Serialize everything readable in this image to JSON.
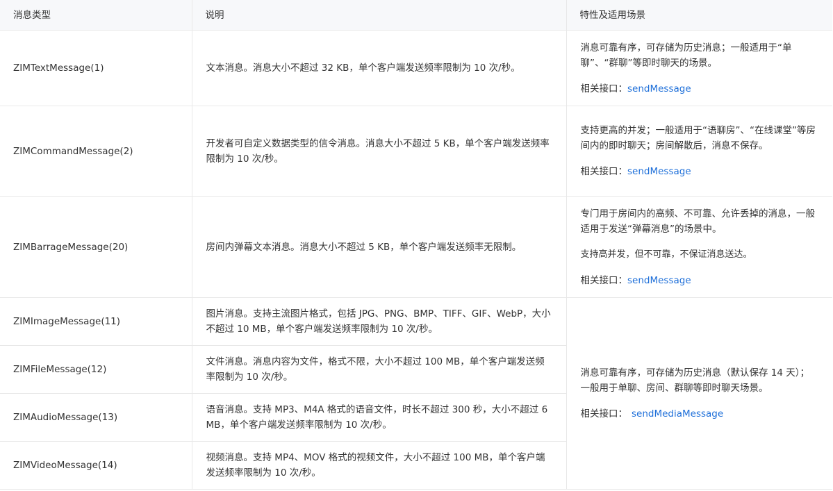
{
  "headers": [
    "消息类型",
    "说明",
    "特性及适用场景"
  ],
  "rows": [
    {
      "type": "ZIMTextMessage(1)",
      "desc": "文本消息。消息大小不超过 32 KB，单个客户端发送频率限制为 10 次/秒。",
      "feat_lines": [
        "消息可靠有序，可存储为历史消息；一般适用于“单聊”、“群聊”等即时聊天的场景。"
      ],
      "api_label": "相关接口：",
      "api": "sendMessage"
    },
    {
      "type": "ZIMCommandMessage(2)",
      "desc": "开发者可自定义数据类型的信令消息。消息大小不超过 5 KB，单个客户端发送频率限制为 10 次/秒。",
      "feat_lines": [
        "支持更高的并发；一般适用于“语聊房”、“在线课堂”等房间内的即时聊天；房间解散后，消息不保存。"
      ],
      "api_label": "相关接口：",
      "api": "sendMessage"
    },
    {
      "type": "ZIMBarrageMessage(20)",
      "desc": "房间内弹幕文本消息。消息大小不超过 5 KB，单个客户端发送频率无限制。",
      "feat_lines": [
        "专门用于房间内的高频、不可靠、允许丢掉的消息，一般适用于发送“弹幕消息”的场景中。",
        "支持高并发，但不可靠，不保证消息送达。"
      ],
      "api_label": "相关接口：",
      "api": "sendMessage"
    },
    {
      "type": "ZIMImageMessage(11)",
      "desc": "图片消息。支持主流图片格式，包括 JPG、PNG、BMP、TIFF、GIF、WebP，大小不超过 10 MB，单个客户端发送频率限制为 10 次/秒。"
    },
    {
      "type": "ZIMFileMessage(12)",
      "desc": "文件消息。消息内容为文件，格式不限，大小不超过 100 MB，单个客户端发送频率限制为 10 次/秒。"
    },
    {
      "type": "ZIMAudioMessage(13)",
      "desc": "语音消息。支持 MP3、M4A 格式的语音文件，时长不超过 300 秒，大小不超过 6 MB，单个客户端发送频率限制为 10 次/秒。"
    },
    {
      "type": "ZIMVideoMessage(14)",
      "desc": "视频消息。支持 MP4、MOV 格式的视频文件，大小不超过 100 MB，单个客户端发送频率限制为 10 次/秒。"
    }
  ],
  "media_feature": {
    "text": "消息可靠有序，可存储为历史消息（默认保存 14 天）；一般用于单聊、房间、群聊等即时聊天场景。",
    "api_label": "相关接口：",
    "api": "sendMediaMessage"
  },
  "colors": {
    "link": "#1e6fd9",
    "header_bg": "#f7f8fa",
    "border": "#e8e8e8",
    "text": "#333333"
  }
}
